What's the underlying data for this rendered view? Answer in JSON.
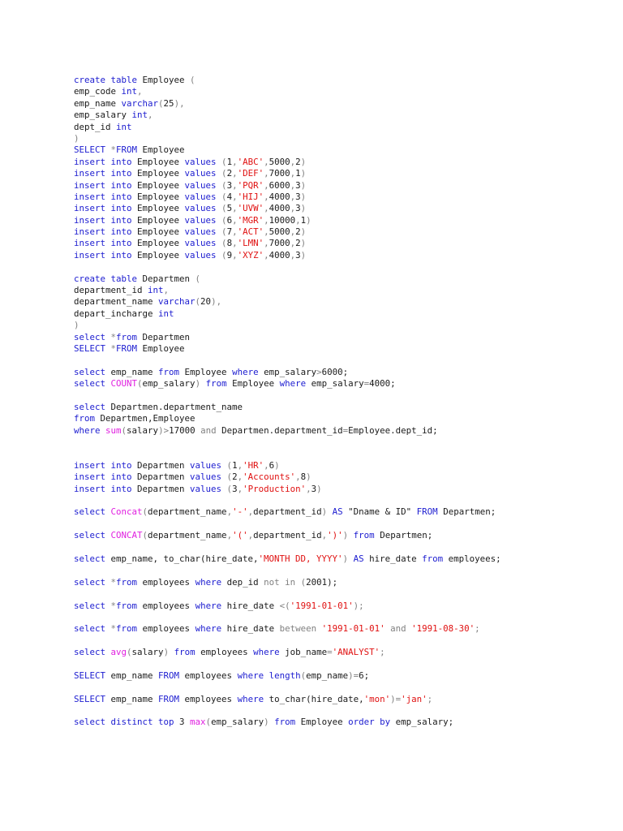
{
  "colors": {
    "keyword": "#1c1cd0",
    "function": "#e020e0",
    "string": "#e01010",
    "operator": "#808080",
    "text": "#1a1a1a"
  },
  "lines": [
    [
      [
        "k",
        "create table"
      ],
      [
        "t",
        " Employee "
      ],
      [
        "g",
        "("
      ]
    ],
    [
      [
        "t",
        "emp_code "
      ],
      [
        "k",
        "int"
      ],
      [
        "g",
        ","
      ]
    ],
    [
      [
        "t",
        "emp_name "
      ],
      [
        "k",
        "varchar"
      ],
      [
        "g",
        "("
      ],
      [
        "t",
        "25"
      ],
      [
        "g",
        "),"
      ]
    ],
    [
      [
        "t",
        "emp_salary "
      ],
      [
        "k",
        "int"
      ],
      [
        "g",
        ","
      ]
    ],
    [
      [
        "t",
        "dept_id "
      ],
      [
        "k",
        "int"
      ]
    ],
    [
      [
        "g",
        ")"
      ]
    ],
    [
      [
        "k",
        "SELECT"
      ],
      [
        "g",
        " *"
      ],
      [
        "k",
        "FROM"
      ],
      [
        "t",
        " Employee"
      ]
    ],
    [
      [
        "k",
        "insert into"
      ],
      [
        "t",
        " Employee "
      ],
      [
        "k",
        "values"
      ],
      [
        "g",
        " ("
      ],
      [
        "t",
        "1"
      ],
      [
        "g",
        ","
      ],
      [
        "s",
        "'ABC'"
      ],
      [
        "g",
        ","
      ],
      [
        "t",
        "5000"
      ],
      [
        "g",
        ","
      ],
      [
        "t",
        "2"
      ],
      [
        "g",
        ")"
      ]
    ],
    [
      [
        "k",
        "insert into"
      ],
      [
        "t",
        " Employee "
      ],
      [
        "k",
        "values"
      ],
      [
        "g",
        " ("
      ],
      [
        "t",
        "2"
      ],
      [
        "g",
        ","
      ],
      [
        "s",
        "'DEF'"
      ],
      [
        "g",
        ","
      ],
      [
        "t",
        "7000"
      ],
      [
        "g",
        ","
      ],
      [
        "t",
        "1"
      ],
      [
        "g",
        ")"
      ]
    ],
    [
      [
        "k",
        "insert into"
      ],
      [
        "t",
        " Employee "
      ],
      [
        "k",
        "values"
      ],
      [
        "g",
        " ("
      ],
      [
        "t",
        "3"
      ],
      [
        "g",
        ","
      ],
      [
        "s",
        "'PQR'"
      ],
      [
        "g",
        ","
      ],
      [
        "t",
        "6000"
      ],
      [
        "g",
        ","
      ],
      [
        "t",
        "3"
      ],
      [
        "g",
        ")"
      ]
    ],
    [
      [
        "k",
        "insert into"
      ],
      [
        "t",
        " Employee "
      ],
      [
        "k",
        "values"
      ],
      [
        "g",
        " ("
      ],
      [
        "t",
        "4"
      ],
      [
        "g",
        ","
      ],
      [
        "s",
        "'HIJ'"
      ],
      [
        "g",
        ","
      ],
      [
        "t",
        "4000"
      ],
      [
        "g",
        ","
      ],
      [
        "t",
        "3"
      ],
      [
        "g",
        ")"
      ]
    ],
    [
      [
        "k",
        "insert into"
      ],
      [
        "t",
        " Employee "
      ],
      [
        "k",
        "values"
      ],
      [
        "g",
        " ("
      ],
      [
        "t",
        "5"
      ],
      [
        "g",
        ","
      ],
      [
        "s",
        "'UVW'"
      ],
      [
        "g",
        ","
      ],
      [
        "t",
        "4000"
      ],
      [
        "g",
        ","
      ],
      [
        "t",
        "3"
      ],
      [
        "g",
        ")"
      ]
    ],
    [
      [
        "k",
        "insert into"
      ],
      [
        "t",
        " Employee "
      ],
      [
        "k",
        "values"
      ],
      [
        "g",
        " ("
      ],
      [
        "t",
        "6"
      ],
      [
        "g",
        ","
      ],
      [
        "s",
        "'MGR'"
      ],
      [
        "g",
        ","
      ],
      [
        "t",
        "10000"
      ],
      [
        "g",
        ","
      ],
      [
        "t",
        "1"
      ],
      [
        "g",
        ")"
      ]
    ],
    [
      [
        "k",
        "insert into"
      ],
      [
        "t",
        " Employee "
      ],
      [
        "k",
        "values"
      ],
      [
        "g",
        " ("
      ],
      [
        "t",
        "7"
      ],
      [
        "g",
        ","
      ],
      [
        "s",
        "'ACT'"
      ],
      [
        "g",
        ","
      ],
      [
        "t",
        "5000"
      ],
      [
        "g",
        ","
      ],
      [
        "t",
        "2"
      ],
      [
        "g",
        ")"
      ]
    ],
    [
      [
        "k",
        "insert into"
      ],
      [
        "t",
        " Employee "
      ],
      [
        "k",
        "values"
      ],
      [
        "g",
        " ("
      ],
      [
        "t",
        "8"
      ],
      [
        "g",
        ","
      ],
      [
        "s",
        "'LMN'"
      ],
      [
        "g",
        ","
      ],
      [
        "t",
        "7000"
      ],
      [
        "g",
        ","
      ],
      [
        "t",
        "2"
      ],
      [
        "g",
        ")"
      ]
    ],
    [
      [
        "k",
        "insert into"
      ],
      [
        "t",
        " Employee "
      ],
      [
        "k",
        "values"
      ],
      [
        "g",
        " ("
      ],
      [
        "t",
        "9"
      ],
      [
        "g",
        ","
      ],
      [
        "s",
        "'XYZ'"
      ],
      [
        "g",
        ","
      ],
      [
        "t",
        "4000"
      ],
      [
        "g",
        ","
      ],
      [
        "t",
        "3"
      ],
      [
        "g",
        ")"
      ]
    ],
    [],
    [
      [
        "k",
        "create table"
      ],
      [
        "t",
        " Departmen "
      ],
      [
        "g",
        "("
      ]
    ],
    [
      [
        "t",
        "department_id "
      ],
      [
        "k",
        "int"
      ],
      [
        "g",
        ","
      ]
    ],
    [
      [
        "t",
        "department_name "
      ],
      [
        "k",
        "varchar"
      ],
      [
        "g",
        "("
      ],
      [
        "t",
        "20"
      ],
      [
        "g",
        "),"
      ]
    ],
    [
      [
        "t",
        "depart_incharge "
      ],
      [
        "k",
        "int"
      ]
    ],
    [
      [
        "g",
        ")"
      ]
    ],
    [
      [
        "k",
        "select"
      ],
      [
        "g",
        " *"
      ],
      [
        "k",
        "from"
      ],
      [
        "t",
        " Departmen"
      ]
    ],
    [
      [
        "k",
        "SELECT"
      ],
      [
        "g",
        " *"
      ],
      [
        "k",
        "FROM"
      ],
      [
        "t",
        " Employee"
      ]
    ],
    [],
    [
      [
        "k",
        "select"
      ],
      [
        "t",
        " emp_name "
      ],
      [
        "k",
        "from"
      ],
      [
        "t",
        " Employee "
      ],
      [
        "k",
        "where"
      ],
      [
        "t",
        " emp_salary"
      ],
      [
        "g",
        ">"
      ],
      [
        "t",
        "6000;"
      ]
    ],
    [
      [
        "k",
        "select "
      ],
      [
        "f",
        "COUNT"
      ],
      [
        "g",
        "("
      ],
      [
        "t",
        "emp_salary"
      ],
      [
        "g",
        ")"
      ],
      [
        "k",
        " from"
      ],
      [
        "t",
        " Employee "
      ],
      [
        "k",
        "where"
      ],
      [
        "t",
        " emp_salary"
      ],
      [
        "g",
        "="
      ],
      [
        "t",
        "4000;"
      ]
    ],
    [],
    [
      [
        "k",
        "select"
      ],
      [
        "t",
        " Departmen.department_name"
      ]
    ],
    [
      [
        "k",
        "from"
      ],
      [
        "t",
        " Departmen,Employee"
      ]
    ],
    [
      [
        "k",
        "where "
      ],
      [
        "f",
        "sum"
      ],
      [
        "g",
        "("
      ],
      [
        "t",
        "salary"
      ],
      [
        "g",
        ")>"
      ],
      [
        "t",
        "17000 "
      ],
      [
        "g",
        "and"
      ],
      [
        "t",
        " Departmen.department_id"
      ],
      [
        "g",
        "="
      ],
      [
        "t",
        "Employee.dept_id;"
      ]
    ],
    [],
    [],
    [
      [
        "k",
        "insert into"
      ],
      [
        "t",
        " Departmen "
      ],
      [
        "k",
        "values"
      ],
      [
        "g",
        " ("
      ],
      [
        "t",
        "1"
      ],
      [
        "g",
        ","
      ],
      [
        "s",
        "'HR'"
      ],
      [
        "g",
        ","
      ],
      [
        "t",
        "6"
      ],
      [
        "g",
        ")"
      ]
    ],
    [
      [
        "k",
        "insert into"
      ],
      [
        "t",
        " Departmen "
      ],
      [
        "k",
        "values"
      ],
      [
        "g",
        " ("
      ],
      [
        "t",
        "2"
      ],
      [
        "g",
        ","
      ],
      [
        "s",
        "'Accounts'"
      ],
      [
        "g",
        ","
      ],
      [
        "t",
        "8"
      ],
      [
        "g",
        ")"
      ]
    ],
    [
      [
        "k",
        "insert into"
      ],
      [
        "t",
        " Departmen "
      ],
      [
        "k",
        "values"
      ],
      [
        "g",
        " ("
      ],
      [
        "t",
        "3"
      ],
      [
        "g",
        ","
      ],
      [
        "s",
        "'Production'"
      ],
      [
        "g",
        ","
      ],
      [
        "t",
        "3"
      ],
      [
        "g",
        ")"
      ]
    ],
    [],
    [
      [
        "k",
        "select "
      ],
      [
        "f",
        "Concat"
      ],
      [
        "g",
        "("
      ],
      [
        "t",
        "department_name"
      ],
      [
        "g",
        ","
      ],
      [
        "s",
        "'-'"
      ],
      [
        "g",
        ","
      ],
      [
        "t",
        "department_id"
      ],
      [
        "g",
        ") "
      ],
      [
        "k",
        "AS"
      ],
      [
        "t",
        " \"Dname & ID\" "
      ],
      [
        "k",
        "FROM"
      ],
      [
        "t",
        " Departmen;"
      ]
    ],
    [],
    [
      [
        "k",
        "select "
      ],
      [
        "f",
        "CONCAT"
      ],
      [
        "g",
        "("
      ],
      [
        "t",
        "department_name"
      ],
      [
        "g",
        ","
      ],
      [
        "s",
        "'('"
      ],
      [
        "g",
        ","
      ],
      [
        "t",
        "department_id"
      ],
      [
        "g",
        ","
      ],
      [
        "s",
        "')'"
      ],
      [
        "g",
        ") "
      ],
      [
        "k",
        "from"
      ],
      [
        "t",
        " Departmen;"
      ]
    ],
    [],
    [
      [
        "k",
        "select"
      ],
      [
        "t",
        " emp_name, to_char(hire_date,"
      ],
      [
        "s",
        "'MONTH DD, YYYY'"
      ],
      [
        "g",
        ") "
      ],
      [
        "k",
        "AS"
      ],
      [
        "t",
        " hire_date "
      ],
      [
        "k",
        "from"
      ],
      [
        "t",
        " employees;"
      ]
    ],
    [],
    [
      [
        "k",
        "select"
      ],
      [
        "g",
        " *"
      ],
      [
        "k",
        "from"
      ],
      [
        "t",
        " employees "
      ],
      [
        "k",
        "where"
      ],
      [
        "t",
        " dep_id "
      ],
      [
        "g",
        "not in ("
      ],
      [
        "t",
        "2001);"
      ]
    ],
    [],
    [
      [
        "k",
        "select"
      ],
      [
        "g",
        " *"
      ],
      [
        "k",
        "from"
      ],
      [
        "t",
        " employees "
      ],
      [
        "k",
        "where"
      ],
      [
        "t",
        " hire_date "
      ],
      [
        "g",
        "<("
      ],
      [
        "s",
        "'1991-01-01'"
      ],
      [
        "g",
        ");"
      ]
    ],
    [],
    [
      [
        "k",
        "select"
      ],
      [
        "g",
        " *"
      ],
      [
        "k",
        "from"
      ],
      [
        "t",
        " employees "
      ],
      [
        "k",
        "where"
      ],
      [
        "t",
        " hire_date "
      ],
      [
        "g",
        "between "
      ],
      [
        "s",
        "'1991-01-01'"
      ],
      [
        "g",
        " and "
      ],
      [
        "s",
        "'1991-08-30'"
      ],
      [
        "g",
        ";"
      ]
    ],
    [],
    [
      [
        "k",
        "select "
      ],
      [
        "f",
        "avg"
      ],
      [
        "g",
        "("
      ],
      [
        "t",
        "salary"
      ],
      [
        "g",
        ") "
      ],
      [
        "k",
        "from"
      ],
      [
        "t",
        " employees "
      ],
      [
        "k",
        "where"
      ],
      [
        "t",
        " job_name"
      ],
      [
        "g",
        "="
      ],
      [
        "s",
        "'ANALYST'"
      ],
      [
        "g",
        ";"
      ]
    ],
    [],
    [
      [
        "k",
        "SELECT"
      ],
      [
        "t",
        " emp_name "
      ],
      [
        "k",
        "FROM"
      ],
      [
        "t",
        " employees "
      ],
      [
        "k",
        "where length"
      ],
      [
        "g",
        "("
      ],
      [
        "t",
        "emp_name"
      ],
      [
        "g",
        ")="
      ],
      [
        "t",
        "6;"
      ]
    ],
    [],
    [
      [
        "k",
        "SELECT"
      ],
      [
        "t",
        " emp_name "
      ],
      [
        "k",
        "FROM"
      ],
      [
        "t",
        " employees "
      ],
      [
        "k",
        "where"
      ],
      [
        "t",
        " to_char(hire_date,"
      ],
      [
        "s",
        "'mon'"
      ],
      [
        "g",
        ")="
      ],
      [
        "s",
        "'jan'"
      ],
      [
        "g",
        ";"
      ]
    ],
    [],
    [
      [
        "k",
        "select distinct top"
      ],
      [
        "t",
        " 3 "
      ],
      [
        "f",
        "max"
      ],
      [
        "g",
        "("
      ],
      [
        "t",
        "emp_salary"
      ],
      [
        "g",
        ") "
      ],
      [
        "k",
        "from"
      ],
      [
        "t",
        " Employee "
      ],
      [
        "k",
        "order by"
      ],
      [
        "t",
        " emp_salary;"
      ]
    ]
  ]
}
